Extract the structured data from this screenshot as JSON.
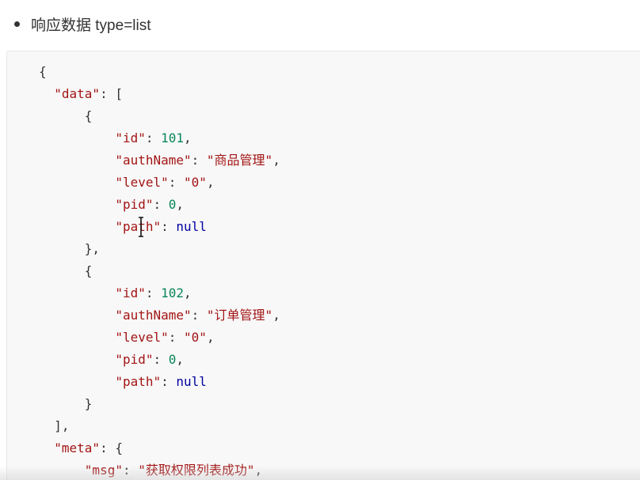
{
  "heading": {
    "text": "响应数据 type=list"
  },
  "code": {
    "lines": [
      [
        {
          "t": "p",
          "v": "{"
        }
      ],
      [
        {
          "t": "p",
          "v": "  "
        },
        {
          "t": "k",
          "v": "\"data\""
        },
        {
          "t": "p",
          "v": ": ["
        }
      ],
      [
        {
          "t": "p",
          "v": "      {"
        }
      ],
      [
        {
          "t": "p",
          "v": "          "
        },
        {
          "t": "k",
          "v": "\"id\""
        },
        {
          "t": "p",
          "v": ": "
        },
        {
          "t": "n",
          "v": "101"
        },
        {
          "t": "p",
          "v": ","
        }
      ],
      [
        {
          "t": "p",
          "v": "          "
        },
        {
          "t": "k",
          "v": "\"authName\""
        },
        {
          "t": "p",
          "v": ": "
        },
        {
          "t": "s",
          "v": "\"商品管理\""
        },
        {
          "t": "p",
          "v": ","
        }
      ],
      [
        {
          "t": "p",
          "v": "          "
        },
        {
          "t": "k",
          "v": "\"level\""
        },
        {
          "t": "p",
          "v": ": "
        },
        {
          "t": "s",
          "v": "\"0\""
        },
        {
          "t": "p",
          "v": ","
        }
      ],
      [
        {
          "t": "p",
          "v": "          "
        },
        {
          "t": "k",
          "v": "\"pid\""
        },
        {
          "t": "p",
          "v": ": "
        },
        {
          "t": "n",
          "v": "0"
        },
        {
          "t": "p",
          "v": ","
        }
      ],
      [
        {
          "t": "p",
          "v": "          "
        },
        {
          "t": "k",
          "v": "\"path\""
        },
        {
          "t": "p",
          "v": ": "
        },
        {
          "t": "z",
          "v": "null"
        }
      ],
      [
        {
          "t": "p",
          "v": "      },"
        }
      ],
      [
        {
          "t": "p",
          "v": "      {"
        }
      ],
      [
        {
          "t": "p",
          "v": "          "
        },
        {
          "t": "k",
          "v": "\"id\""
        },
        {
          "t": "p",
          "v": ": "
        },
        {
          "t": "n",
          "v": "102"
        },
        {
          "t": "p",
          "v": ","
        }
      ],
      [
        {
          "t": "p",
          "v": "          "
        },
        {
          "t": "k",
          "v": "\"authName\""
        },
        {
          "t": "p",
          "v": ": "
        },
        {
          "t": "s",
          "v": "\"订单管理\""
        },
        {
          "t": "p",
          "v": ","
        }
      ],
      [
        {
          "t": "p",
          "v": "          "
        },
        {
          "t": "k",
          "v": "\"level\""
        },
        {
          "t": "p",
          "v": ": "
        },
        {
          "t": "s",
          "v": "\"0\""
        },
        {
          "t": "p",
          "v": ","
        }
      ],
      [
        {
          "t": "p",
          "v": "          "
        },
        {
          "t": "k",
          "v": "\"pid\""
        },
        {
          "t": "p",
          "v": ": "
        },
        {
          "t": "n",
          "v": "0"
        },
        {
          "t": "p",
          "v": ","
        }
      ],
      [
        {
          "t": "p",
          "v": "          "
        },
        {
          "t": "k",
          "v": "\"path\""
        },
        {
          "t": "p",
          "v": ": "
        },
        {
          "t": "z",
          "v": "null"
        }
      ],
      [
        {
          "t": "p",
          "v": "      }"
        }
      ],
      [
        {
          "t": "p",
          "v": "  ],"
        }
      ],
      [
        {
          "t": "p",
          "v": "  "
        },
        {
          "t": "k",
          "v": "\"meta\""
        },
        {
          "t": "p",
          "v": ": {"
        }
      ],
      [
        {
          "t": "p",
          "v": "      "
        },
        {
          "t": "k",
          "v": "\"msg\""
        },
        {
          "t": "p",
          "v": ": "
        },
        {
          "t": "s",
          "v": "\"获取权限列表成功\""
        },
        {
          "t": "p",
          "v": ","
        }
      ]
    ]
  },
  "colors": {
    "key": "#a31515",
    "string": "#a31515",
    "number": "#098658",
    "null": "#0000a0",
    "punctuation": "#333333",
    "code_background": "#f8f8f8"
  },
  "cursor": {
    "icon": "text-cursor-icon"
  }
}
